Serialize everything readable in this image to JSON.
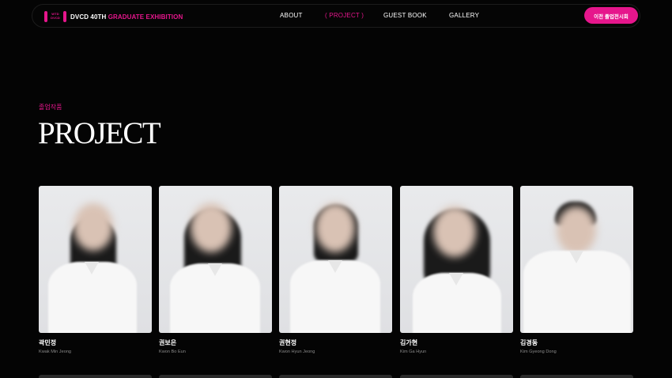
{
  "brand": {
    "logo_mark": "ㅊWTD\nDVCD",
    "name_white": "DVCD 40TH",
    "name_pink": "GRADUATE EXHIBITION"
  },
  "nav": {
    "items": [
      {
        "label": "ABOUT"
      },
      {
        "label": "( PROJECT )"
      },
      {
        "label": "GUEST BOOK"
      },
      {
        "label": "GALLERY"
      }
    ],
    "cta_label": "이전 졸업전시회"
  },
  "section": {
    "subtitle": "졸업작품",
    "title": "PROJECT"
  },
  "students": [
    {
      "name": "곽민정",
      "name_en": "Kwak Min Jeong"
    },
    {
      "name": "권보은",
      "name_en": "Kwon Bo Eun"
    },
    {
      "name": "권현정",
      "name_en": "Kwon Hyun Jeong"
    },
    {
      "name": "김가현",
      "name_en": "Kim Ga Hyun"
    },
    {
      "name": "김경동",
      "name_en": "Kim Gyeong Dong"
    }
  ],
  "colors": {
    "accent": "#e6168c",
    "background": "#040404"
  }
}
